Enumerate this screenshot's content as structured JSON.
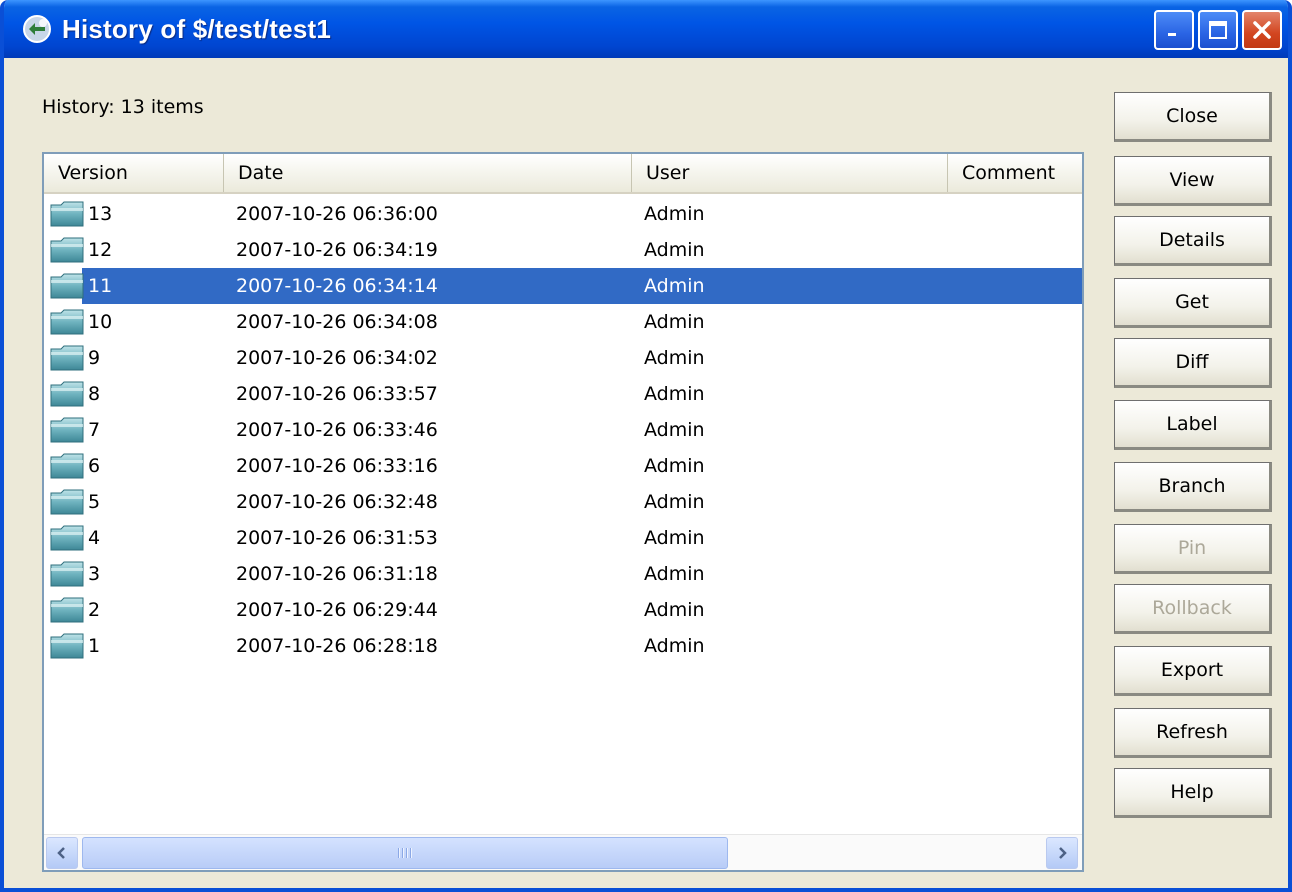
{
  "window": {
    "title": "History of $/test/test1"
  },
  "history": {
    "label": "History: 13 items"
  },
  "columns": [
    "Version",
    "Date",
    "User",
    "Comment"
  ],
  "rows": [
    {
      "version": "13",
      "date": "2007-10-26 06:36:00",
      "user": "Admin",
      "comment": ""
    },
    {
      "version": "12",
      "date": "2007-10-26 06:34:19",
      "user": "Admin",
      "comment": ""
    },
    {
      "version": "11",
      "date": "2007-10-26 06:34:14",
      "user": "Admin",
      "comment": ""
    },
    {
      "version": "10",
      "date": "2007-10-26 06:34:08",
      "user": "Admin",
      "comment": ""
    },
    {
      "version": "9",
      "date": "2007-10-26 06:34:02",
      "user": "Admin",
      "comment": ""
    },
    {
      "version": "8",
      "date": "2007-10-26 06:33:57",
      "user": "Admin",
      "comment": ""
    },
    {
      "version": "7",
      "date": "2007-10-26 06:33:46",
      "user": "Admin",
      "comment": ""
    },
    {
      "version": "6",
      "date": "2007-10-26 06:33:16",
      "user": "Admin",
      "comment": ""
    },
    {
      "version": "5",
      "date": "2007-10-26 06:32:48",
      "user": "Admin",
      "comment": ""
    },
    {
      "version": "4",
      "date": "2007-10-26 06:31:53",
      "user": "Admin",
      "comment": ""
    },
    {
      "version": "3",
      "date": "2007-10-26 06:31:18",
      "user": "Admin",
      "comment": ""
    },
    {
      "version": "2",
      "date": "2007-10-26 06:29:44",
      "user": "Admin",
      "comment": ""
    },
    {
      "version": "1",
      "date": "2007-10-26 06:28:18",
      "user": "Admin",
      "comment": ""
    }
  ],
  "selected_version": "11",
  "buttons": {
    "close": "Close",
    "view": "View",
    "details": "Details",
    "get": "Get",
    "diff": "Diff",
    "label": "Label",
    "branch": "Branch",
    "pin": "Pin",
    "rollback": "Rollback",
    "export": "Export",
    "refresh": "Refresh",
    "help": "Help"
  },
  "disabled_buttons": [
    "pin",
    "rollback"
  ],
  "icons": {
    "title": "app-icon",
    "row": "folder-icon",
    "minimize": "minimize-icon",
    "maximize": "maximize-icon",
    "close": "close-icon",
    "scroll_left": "arrow-left-icon",
    "scroll_right": "arrow-right-icon"
  },
  "colors": {
    "titlebar": "#0055e5",
    "selection": "#316ac5",
    "close_button": "#d2451f",
    "disabled_text": "#aca899",
    "window_bg": "#ece9d8"
  }
}
